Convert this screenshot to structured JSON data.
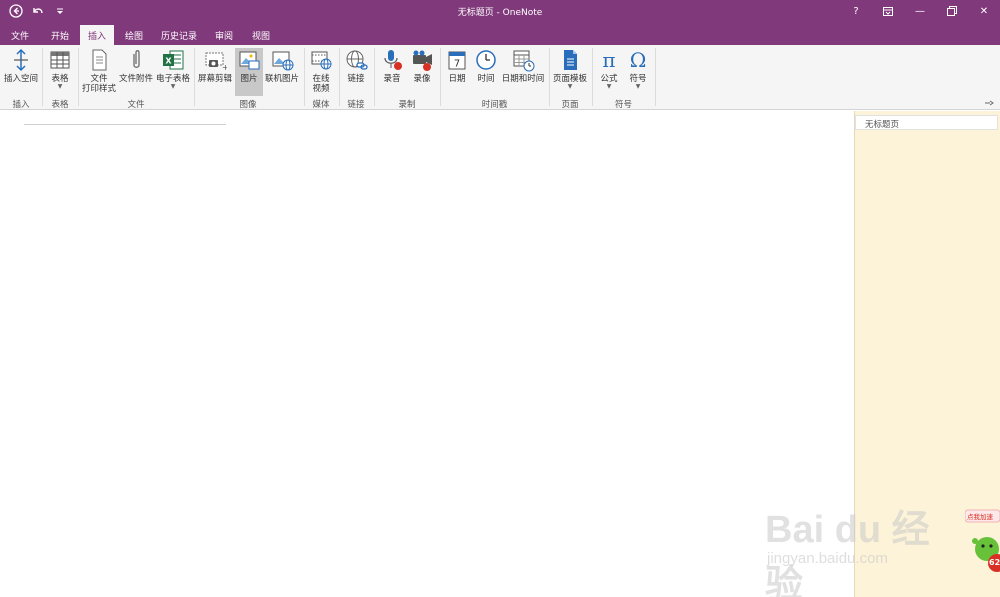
{
  "window": {
    "title": "无标题页 - OneNote"
  },
  "qat": {
    "back_icon": "back-circle-icon",
    "undo_icon": "undo-icon",
    "customize_icon": "qat-dropdown-icon"
  },
  "window_controls": {
    "help": "?",
    "ribbon_display": "ribbon-display-icon",
    "minimize": "—",
    "restore": "restore-icon",
    "close": "✕"
  },
  "tabs": [
    {
      "label": "文件"
    },
    {
      "label": "开始"
    },
    {
      "label": "插入",
      "active": true
    },
    {
      "label": "绘图"
    },
    {
      "label": "历史记录"
    },
    {
      "label": "审阅"
    },
    {
      "label": "视图"
    }
  ],
  "ribbon": {
    "buttons": {
      "insert_space": "插入空间",
      "table": "表格",
      "file_printout_1": "文件",
      "file_printout_2": "打印样式",
      "file_attachment": "文件附件",
      "spreadsheet": "电子表格",
      "screen_clipping": "屏幕剪辑",
      "picture": "图片",
      "online_picture": "联机图片",
      "online_video_1": "在线",
      "online_video_2": "视频",
      "link": "链接",
      "record_audio": "录音",
      "record_video": "录像",
      "date": "日期",
      "time": "时间",
      "date_time": "日期和时间",
      "page_templates": "页面模板",
      "equation": "公式",
      "symbol": "符号"
    },
    "groups": {
      "insert": "插入",
      "tables": "表格",
      "files": "文件",
      "images": "图像",
      "media": "媒体",
      "links": "链接",
      "recording": "录制",
      "timestamp": "时间戳",
      "pages": "页面",
      "symbols": "符号"
    },
    "icons": {
      "equation_glyph": "π",
      "symbol_glyph": "Ω",
      "date_glyph": "7"
    }
  },
  "pagelist": {
    "items": [
      {
        "label": "无标题页"
      }
    ]
  },
  "watermark": {
    "main": "Bai du 经验",
    "sub": "jingyan.baidu.com",
    "badge_text": "点我加速",
    "badge_number": "62"
  },
  "colors": {
    "accent": "#80397b",
    "ribbon_bg": "#f5f5f5",
    "pagelist_bg": "#fdf3d8"
  }
}
